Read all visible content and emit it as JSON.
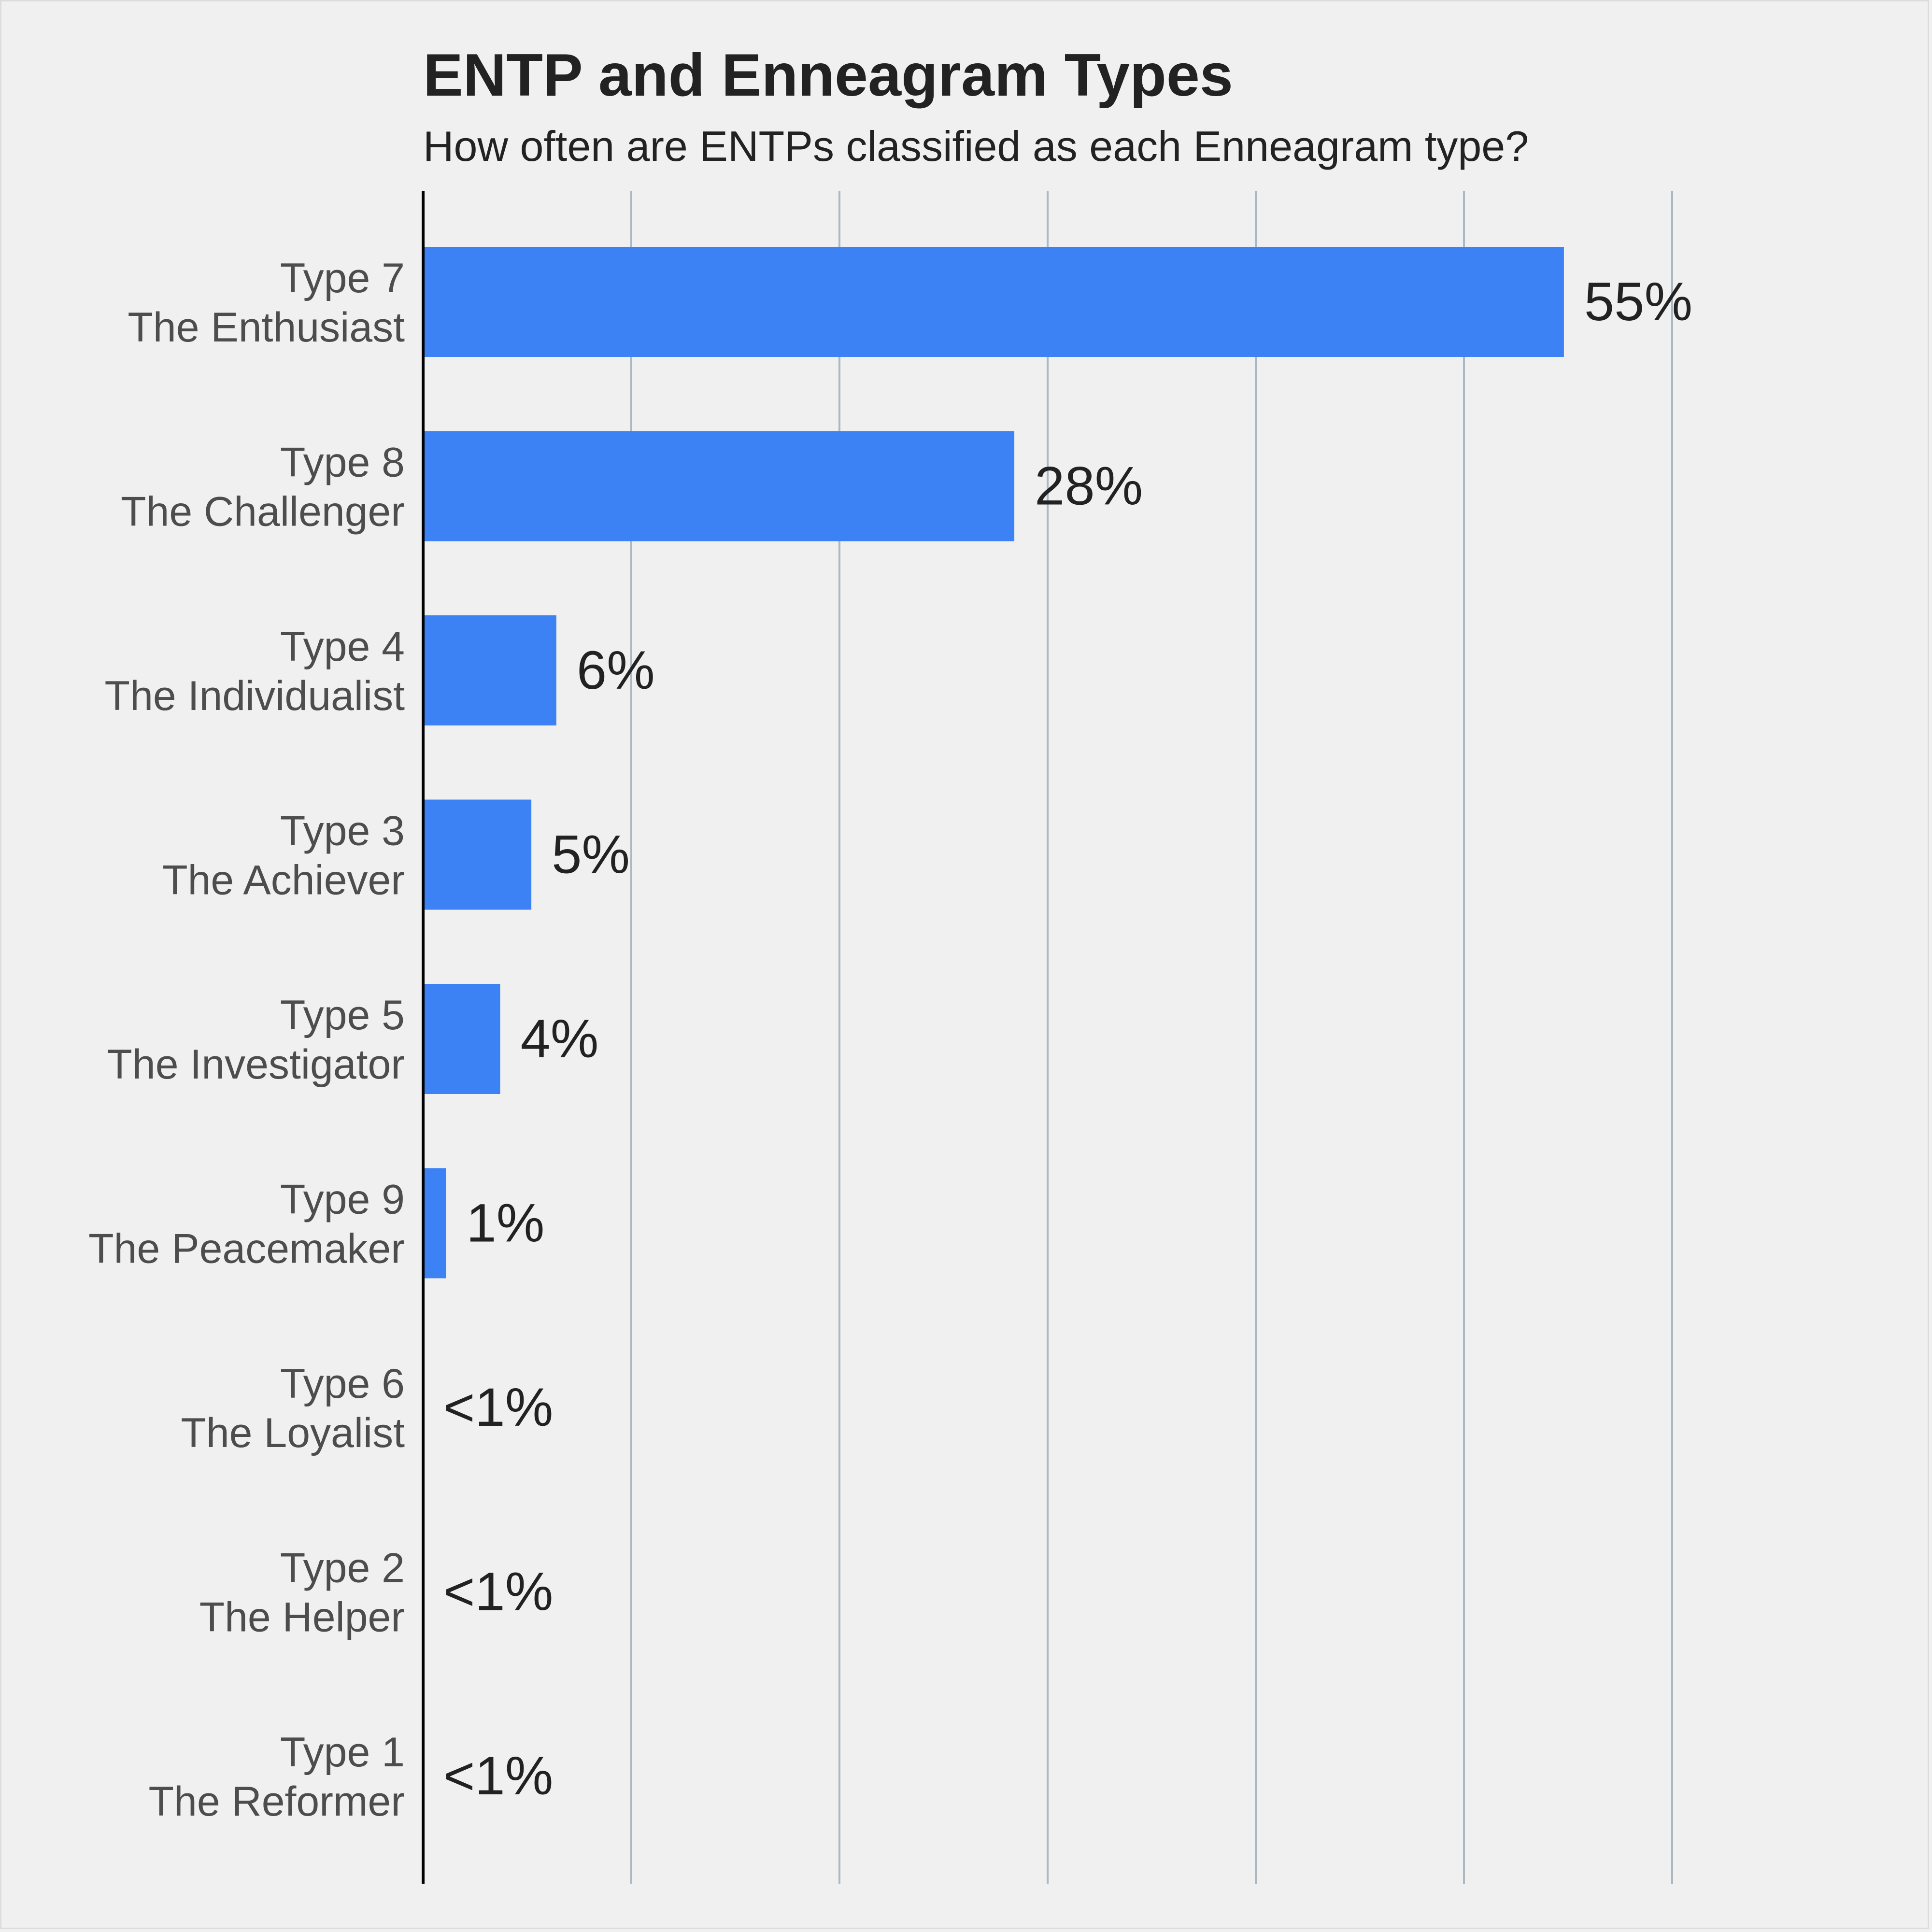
{
  "chart_data": {
    "type": "bar",
    "orientation": "horizontal",
    "title": "ENTP and Enneagram Types",
    "subtitle": "How often are ENTPs classified as each Enneagram type?",
    "xlabel": "",
    "ylabel": "",
    "xlim": [
      0,
      65
    ],
    "grid": true,
    "grid_step": 10,
    "bar_color": "#3d82f4",
    "gridline_color": "#a9b8c5",
    "categories": [
      {
        "type": "Type 7",
        "name": "The Enthusiast"
      },
      {
        "type": "Type 8",
        "name": "The Challenger"
      },
      {
        "type": "Type 4",
        "name": "The Individualist"
      },
      {
        "type": "Type 3",
        "name": "The Achiever"
      },
      {
        "type": "Type 5",
        "name": "The Investigator"
      },
      {
        "type": "Type 9",
        "name": "The Peacemaker"
      },
      {
        "type": "Type 6",
        "name": "The Loyalist"
      },
      {
        "type": "Type 2",
        "name": "The Helper"
      },
      {
        "type": "Type 1",
        "name": "The Reformer"
      }
    ],
    "values": [
      54.8,
      28.4,
      6.4,
      5.2,
      3.7,
      1.1,
      0,
      0,
      0
    ],
    "data_labels": [
      "55%",
      "28%",
      "6%",
      "5%",
      "4%",
      "1%",
      "<1%",
      "<1%",
      "<1%"
    ]
  }
}
